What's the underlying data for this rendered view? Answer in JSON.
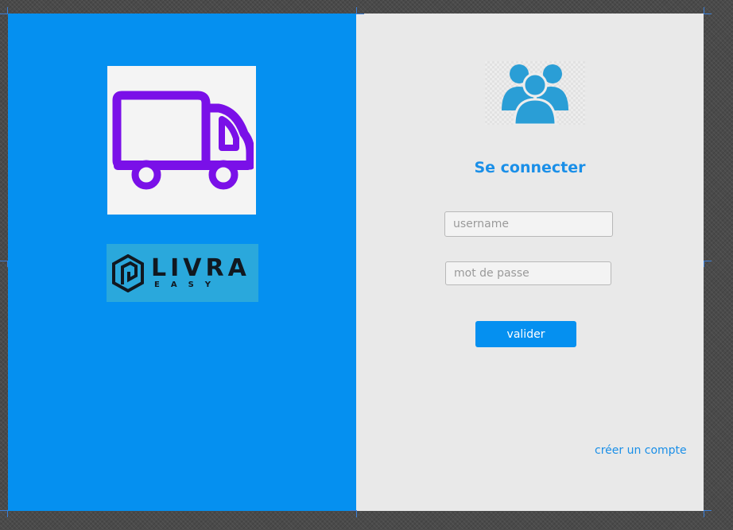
{
  "left_panel": {
    "truck_icon": "truck-icon",
    "brand": {
      "name": "LIVRA",
      "tagline": "EASY",
      "mark_icon": "hexagon-logo-icon"
    }
  },
  "login": {
    "users_icon": "users-group-icon",
    "title": "Se connecter",
    "username": {
      "value": "",
      "placeholder": "username"
    },
    "password": {
      "value": "",
      "placeholder": "mot de passe"
    },
    "submit_label": "valider",
    "signup_label": "créer un compte"
  },
  "colors": {
    "primary_blue": "#0590f0",
    "truck_purple": "#7a10e8",
    "users_blue": "#2a9ed6",
    "right_bg": "#e9e9e9"
  }
}
